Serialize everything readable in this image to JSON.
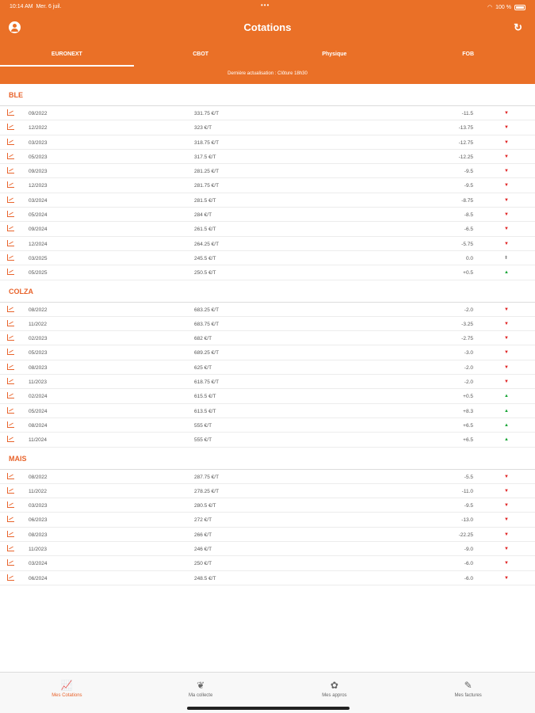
{
  "status_bar": {
    "time": "10:14 AM",
    "date": "Mer. 6 juil.",
    "multitask": "•••",
    "wifi_icon": "wifi-icon",
    "battery": "100 %"
  },
  "header": {
    "title": "Cotations",
    "left_icon": "user-circle-icon",
    "right_icon": "refresh-icon",
    "background_color": "#ea7027"
  },
  "tabs": [
    {
      "label": "EURONEXT",
      "active": true
    },
    {
      "label": "CBOT",
      "active": false
    },
    {
      "label": "Physique",
      "active": false
    },
    {
      "label": "FOB",
      "active": false
    }
  ],
  "last_update": "Dernière actualisation : Clôture 18h30",
  "sections": [
    {
      "title": "BLE",
      "rows": [
        {
          "date": "09/2022",
          "price": "331.75 €/T",
          "change": "-11.5",
          "trend": "down"
        },
        {
          "date": "12/2022",
          "price": "323 €/T",
          "change": "-13.75",
          "trend": "down"
        },
        {
          "date": "03/2023",
          "price": "318.75 €/T",
          "change": "-12.75",
          "trend": "down"
        },
        {
          "date": "05/2023",
          "price": "317.5 €/T",
          "change": "-12.25",
          "trend": "down"
        },
        {
          "date": "09/2023",
          "price": "281.25 €/T",
          "change": "-9.5",
          "trend": "down"
        },
        {
          "date": "12/2023",
          "price": "281.75 €/T",
          "change": "-9.5",
          "trend": "down"
        },
        {
          "date": "03/2024",
          "price": "281.5 €/T",
          "change": "-8.75",
          "trend": "down"
        },
        {
          "date": "05/2024",
          "price": "284 €/T",
          "change": "-8.5",
          "trend": "down"
        },
        {
          "date": "09/2024",
          "price": "261.5 €/T",
          "change": "-6.5",
          "trend": "down"
        },
        {
          "date": "12/2024",
          "price": "264.25 €/T",
          "change": "-5.75",
          "trend": "down"
        },
        {
          "date": "03/2025",
          "price": "245.5 €/T",
          "change": "0.0",
          "trend": "flat"
        },
        {
          "date": "05/2025",
          "price": "250.5 €/T",
          "change": "+0.5",
          "trend": "up"
        }
      ]
    },
    {
      "title": "COLZA",
      "rows": [
        {
          "date": "08/2022",
          "price": "683.25 €/T",
          "change": "-2.0",
          "trend": "down"
        },
        {
          "date": "11/2022",
          "price": "683.75 €/T",
          "change": "-3.25",
          "trend": "down"
        },
        {
          "date": "02/2023",
          "price": "682 €/T",
          "change": "-2.75",
          "trend": "down"
        },
        {
          "date": "05/2023",
          "price": "689.25 €/T",
          "change": "-3.0",
          "trend": "down"
        },
        {
          "date": "08/2023",
          "price": "625 €/T",
          "change": "-2.0",
          "trend": "down"
        },
        {
          "date": "11/2023",
          "price": "618.75 €/T",
          "change": "-2.0",
          "trend": "down"
        },
        {
          "date": "02/2024",
          "price": "615.5 €/T",
          "change": "+0.5",
          "trend": "up"
        },
        {
          "date": "05/2024",
          "price": "613.5 €/T",
          "change": "+8.3",
          "trend": "up"
        },
        {
          "date": "08/2024",
          "price": "555 €/T",
          "change": "+6.5",
          "trend": "up"
        },
        {
          "date": "11/2024",
          "price": "555 €/T",
          "change": "+6.5",
          "trend": "up"
        }
      ]
    },
    {
      "title": "MAIS",
      "rows": [
        {
          "date": "08/2022",
          "price": "287.75 €/T",
          "change": "-5.5",
          "trend": "down"
        },
        {
          "date": "11/2022",
          "price": "278.25 €/T",
          "change": "-11.0",
          "trend": "down"
        },
        {
          "date": "03/2023",
          "price": "280.5 €/T",
          "change": "-9.5",
          "trend": "down"
        },
        {
          "date": "06/2023",
          "price": "272 €/T",
          "change": "-13.0",
          "trend": "down"
        },
        {
          "date": "08/2023",
          "price": "266 €/T",
          "change": "-22.25",
          "trend": "down"
        },
        {
          "date": "11/2023",
          "price": "246 €/T",
          "change": "-9.0",
          "trend": "down"
        },
        {
          "date": "03/2024",
          "price": "250 €/T",
          "change": "-6.0",
          "trend": "down"
        },
        {
          "date": "06/2024",
          "price": "248.5 €/T",
          "change": "-6.0",
          "trend": "down"
        }
      ]
    }
  ],
  "bottom_nav": [
    {
      "label": "Mes Cotations",
      "icon": "chart-line-icon",
      "active": true
    },
    {
      "label": "Ma collecte",
      "icon": "grain-icon",
      "active": false
    },
    {
      "label": "Mes appros",
      "icon": "seed-icon",
      "active": false
    },
    {
      "label": "Mes factures",
      "icon": "pen-icon",
      "active": false
    }
  ]
}
